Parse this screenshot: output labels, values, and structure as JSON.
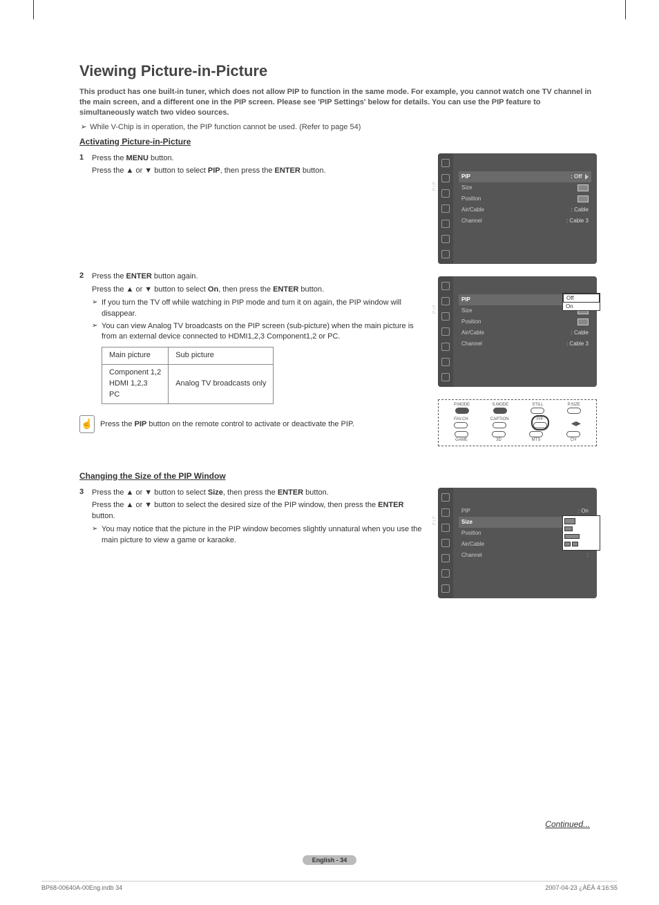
{
  "title": "Viewing Picture-in-Picture",
  "intro": "This product has one built-in tuner, which does not allow PIP to function in the same mode. For example, you cannot watch one TV channel in the main screen, and a different one in the PIP screen. Please see 'PIP Settings' below for details. You can use the PIP feature to simultaneously watch two video sources.",
  "vchip_note": "While V-Chip is in operation, the PIP function cannot be used. (Refer to page 54)",
  "section1_heading": "Activating Picture-in-Picture",
  "step1": {
    "num": "1",
    "line1_a": "Press the ",
    "line1_b": "MENU",
    "line1_c": " button.",
    "line2_a": "Press the ▲ or ▼ button to select ",
    "line2_b": "PIP",
    "line2_c": ", then press the ",
    "line2_d": "ENTER",
    "line2_e": " button."
  },
  "step2": {
    "num": "2",
    "line1_a": "Press the ",
    "line1_b": "ENTER",
    "line1_c": " button again.",
    "line2_a": "Press the ▲ or ▼ button to select ",
    "line2_b": "On",
    "line2_c": ", then press the ",
    "line2_d": "ENTER",
    "line2_e": " button.",
    "note1": "If you turn the TV off while watching in PIP mode and turn it on again, the PIP window will disappear.",
    "note2": "You can view Analog TV broadcasts on the PIP screen (sub-picture) when the main picture is from an external device connected to HDMI1,2,3 Component1,2 or PC."
  },
  "table": {
    "h1": "Main picture",
    "h2": "Sub picture",
    "c1": "Component 1,2\nHDMI 1,2,3\nPC",
    "c2": "Analog TV broadcasts only"
  },
  "hint_a": "Press the ",
  "hint_b": "PIP",
  "hint_c": " button on the remote control to activate or deactivate the PIP.",
  "section2_heading": "Changing the Size of the PIP Window",
  "step3": {
    "num": "3",
    "line1_a": "Press the ▲ or ▼ button to select ",
    "line1_b": "Size",
    "line1_c": ", then press the ",
    "line1_d": "ENTER",
    "line1_e": " button.",
    "line2_a": "Press the ▲ or ▼ button to select the desired size of the PIP window, then press the ",
    "line2_b": "ENTER",
    "line2_c": " button.",
    "note1": "You may notice that the picture in the PIP window becomes slightly unnatural when you use the main picture to view a game or karaoke."
  },
  "osd_common": {
    "pip_vert": "PIP",
    "rows": {
      "pip": "PIP",
      "size": "Size",
      "position": "Position",
      "aircable": "Air/Cable",
      "channel": "Channel"
    },
    "vals": {
      "off": ": Off",
      "on": ": On",
      "cable": ": Cable",
      "cable3": ": Cable 3",
      "colon": ":"
    }
  },
  "osd2_dropdown": {
    "off": "Off",
    "on": "On"
  },
  "remote": {
    "row1": [
      "P.MODE",
      "S.MODE",
      "STILL",
      "P.SIZE"
    ],
    "row2": [
      "FAV.CH",
      "CAPTION",
      "PIP",
      ""
    ],
    "row3": [
      "GAME",
      "3D",
      "MTS",
      "CH"
    ]
  },
  "continued": "Continued...",
  "page_foot": "English - 34",
  "doc_foot_left": "BP68-00640A-00Eng.indb   34",
  "doc_foot_right": "2007-04-23   ¿ÀÈÄ 4:16:55"
}
